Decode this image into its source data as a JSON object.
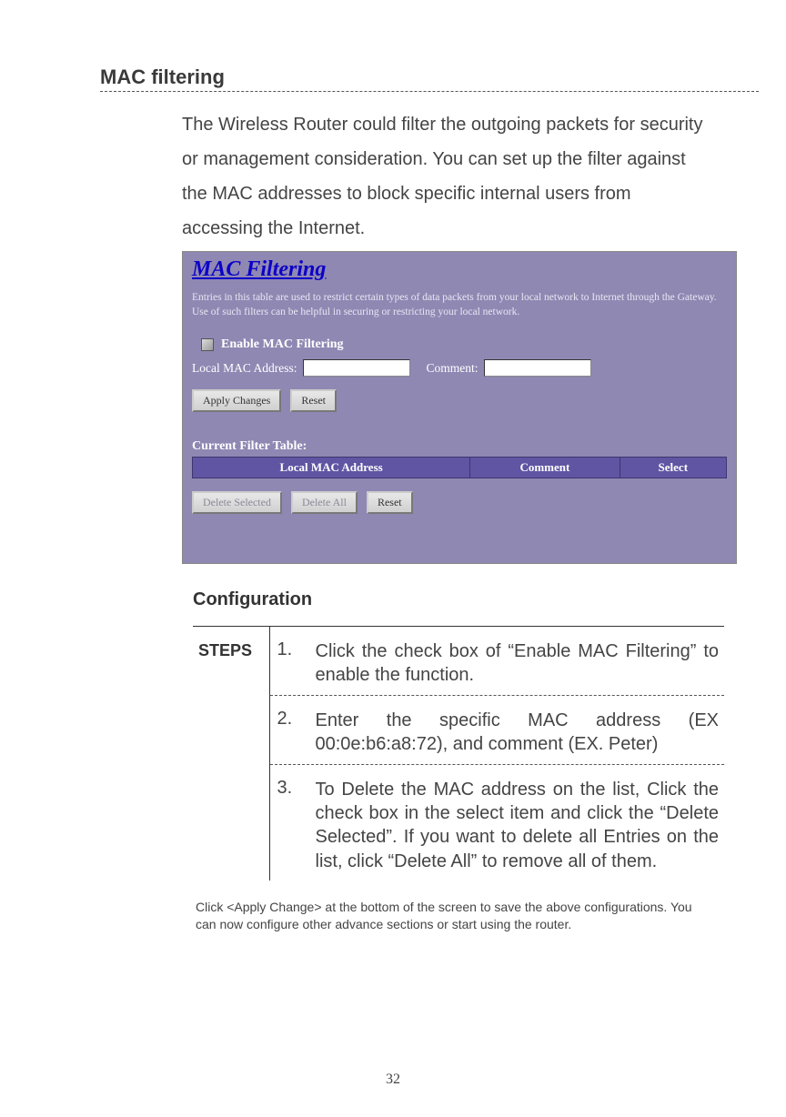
{
  "title": "MAC filtering",
  "intro": "The Wireless Router could filter the outgoing packets for security or management consideration. You can set up the filter against the MAC addresses to block specific internal users from accessing the Internet.",
  "panel": {
    "heading": "MAC Filtering",
    "description": "Entries in this table are used to restrict certain types of data packets from your local network to Internet through the Gateway. Use of such filters can be helpful in securing or restricting your local network.",
    "enable_label": "Enable MAC Filtering",
    "local_mac_label": "Local MAC Address:",
    "comment_label": "Comment:",
    "apply_btn": "Apply Changes",
    "reset_btn": "Reset",
    "table_label": "Current Filter Table:",
    "col_mac": "Local MAC Address",
    "col_comment": "Comment",
    "col_select": "Select",
    "delete_selected_btn": "Delete Selected",
    "delete_all_btn": "Delete All",
    "reset2_btn": "Reset"
  },
  "config_heading": "Configuration",
  "steps_header": "STEPS",
  "steps": [
    {
      "num": "1.",
      "text": "Click the check box of “Enable MAC Filtering” to enable the function."
    },
    {
      "num": "2.",
      "text": "Enter the specific MAC address (EX 00:0e:b6:a8:72), and comment (EX. Peter)"
    },
    {
      "num": "3.",
      "text": "To Delete the MAC address on the list, Click the check box in the select item and click the “Delete Selected”. If you want to delete all Entries on the list, click “Delete All” to remove all of them."
    }
  ],
  "footnote": "Click <Apply Change> at the bottom of the screen to save the above configurations. You can now configure other advance sections or start using the router.",
  "page_number": "32"
}
